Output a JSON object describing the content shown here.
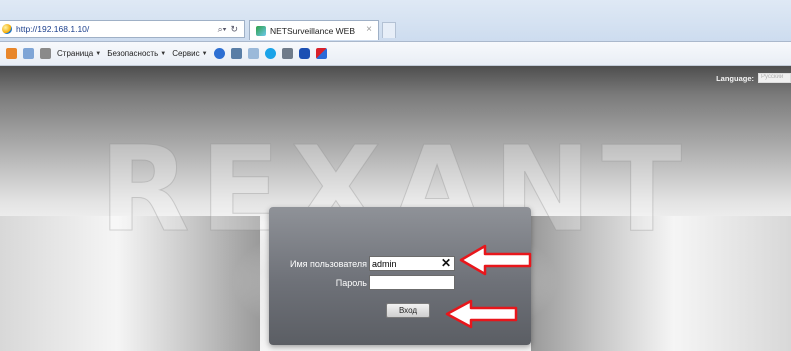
{
  "browser": {
    "address": "http://192.168.1.10/",
    "address_tools": [
      "search-icon",
      "refresh-icon"
    ],
    "tab_title": "NETSurveillance WEB",
    "tab_close": "×",
    "toolbar": {
      "page_menu": "Страница",
      "safety_menu": "Безопасность",
      "tools_menu": "Сервис"
    }
  },
  "page": {
    "language_label": "Language:",
    "language_value": "Русский",
    "brand_watermark": "REXANT",
    "login": {
      "username_label": "Имя пользователя",
      "username_value": "admin",
      "clear_glyph": "✕",
      "password_label": "Пароль",
      "password_value": "",
      "submit_label": "Вход"
    }
  },
  "colors": {
    "annotation_arrow": "#e8161b",
    "panel": "#6e7178"
  }
}
